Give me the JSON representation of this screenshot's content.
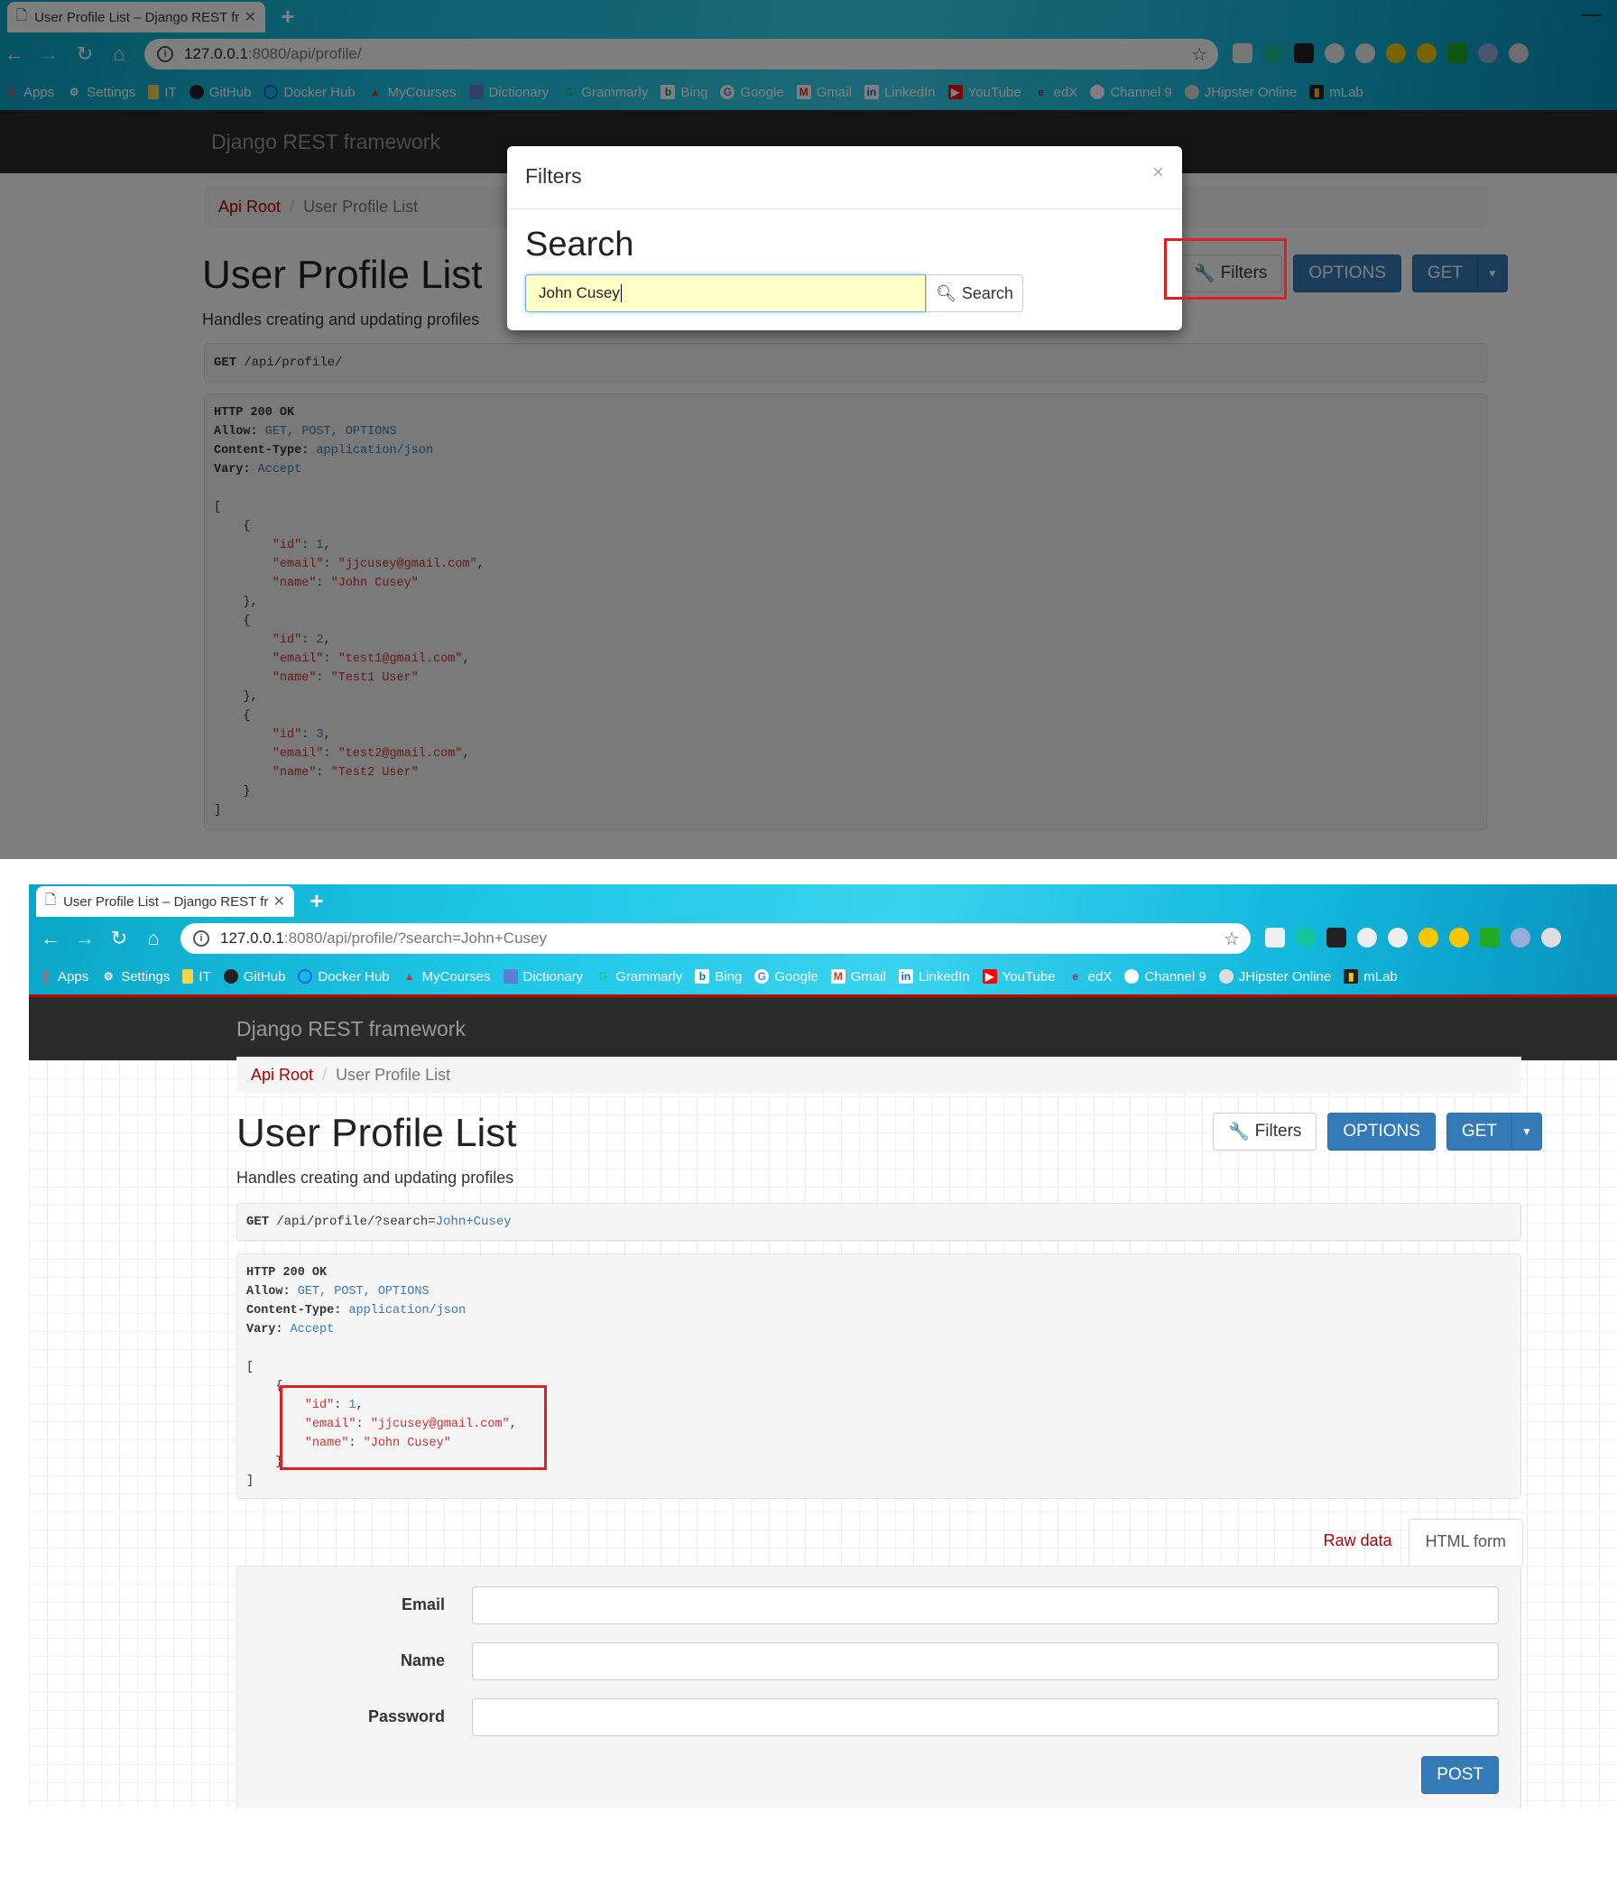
{
  "browser": {
    "tab_title": "User Profile List – Django REST fr",
    "url_host_1": "127.0.0.1",
    "url_path_1": ":8080/api/profile/",
    "url_host_2": "127.0.0.1",
    "url_path_2": ":8080/api/profile/?search=John+Cusey",
    "bookmarks": [
      "Apps",
      "Settings",
      "IT",
      "GitHub",
      "Docker Hub",
      "MyCourses",
      "Dictionary",
      "Grammarly",
      "Bing",
      "Google",
      "Gmail",
      "LinkedIn",
      "YouTube",
      "edX",
      "Channel 9",
      "JHipster Online",
      "mLab"
    ]
  },
  "site": {
    "brand": "Django REST framework",
    "breadcrumb_root": "Api Root",
    "breadcrumb_current": "User Profile List",
    "title": "User Profile List",
    "description": "Handles creating and updating profiles",
    "filters_label": "Filters",
    "options_label": "OPTIONS",
    "get_label": "GET"
  },
  "shot1": {
    "request_method": "GET",
    "request_path": "/api/profile/",
    "response": {
      "status": "HTTP 200 OK",
      "allow_key": "Allow:",
      "allow_val": "GET, POST, OPTIONS",
      "ctype_key": "Content-Type:",
      "ctype_val": "application/json",
      "vary_key": "Vary:",
      "vary_val": "Accept"
    },
    "records": [
      {
        "id": "1",
        "email": "\"jjcusey@gmail.com\"",
        "name": "\"John Cusey\""
      },
      {
        "id": "2",
        "email": "\"test1@gmail.com\"",
        "name": "\"Test1 User\""
      },
      {
        "id": "3",
        "email": "\"test2@gmail.com\"",
        "name": "\"Test2 User\""
      }
    ]
  },
  "modal": {
    "header": "Filters",
    "close": "×",
    "section_title": "Search",
    "search_value": "John Cusey",
    "search_button": "Search"
  },
  "shot2": {
    "request_method": "GET",
    "request_path": "/api/profile/?search=",
    "request_query": "John+Cusey",
    "record": {
      "id": "1",
      "email": "\"jjcusey@gmail.com\"",
      "name": "\"John Cusey\""
    },
    "tabs": {
      "raw": "Raw data",
      "html": "HTML form"
    },
    "form": {
      "email_label": "Email",
      "name_label": "Name",
      "password_label": "Password",
      "submit": "POST"
    }
  },
  "colors": {
    "accent": "#337ab7",
    "link": "#aa0000",
    "highlight": "#e02020",
    "navbar": "#2b2b2b"
  }
}
